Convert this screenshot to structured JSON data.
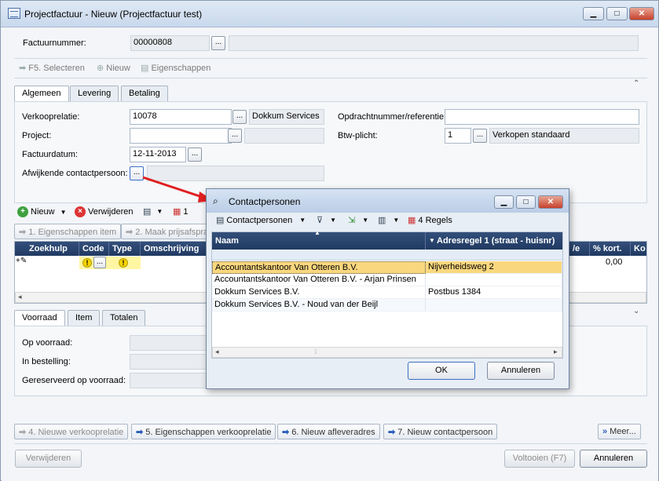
{
  "window": {
    "title": "Projectfactuur - Nieuw (Projectfactuur test)",
    "buttons": {
      "minimize": "▁",
      "maximize": "□",
      "close": "✕"
    }
  },
  "header": {
    "factuurnummer_label": "Factuurnummer:",
    "factuurnummer_value": "00000808",
    "dots": "..."
  },
  "toolbar": {
    "select": "F5. Selecteren",
    "new": "Nieuw",
    "properties": "Eigenschappen"
  },
  "tabs_top": [
    "Algemeen",
    "Levering",
    "Betaling"
  ],
  "form": {
    "verkooprelatie_label": "Verkooprelatie:",
    "verkooprelatie_value": "10078",
    "verkooprelatie_name": "Dokkum Services",
    "project_label": "Project:",
    "factuurdatum_label": "Factuurdatum:",
    "factuurdatum_value": "12-11-2013",
    "contact_label": "Afwijkende contactpersoon:",
    "opdracht_label": "Opdrachtnummer/referentie:",
    "btw_label": "Btw-plicht:",
    "btw_value": "1",
    "btw_name": "Verkopen standaard"
  },
  "lines_toolbar": {
    "new": "Nieuw",
    "delete": "Verwijderen",
    "count": "1"
  },
  "steps": {
    "step1": "1. Eigenschappen item",
    "step2": "2. Maak prijsafspra"
  },
  "lines_grid": {
    "headers": [
      "Zoekhulp",
      "Code",
      "Type",
      "Omschrijving",
      "/e",
      "% kort.",
      "Ko"
    ],
    "row_value": "0,00"
  },
  "tabs_bottom": [
    "Voorraad",
    "Item",
    "Totalen"
  ],
  "stock": {
    "op_voorraad": "Op voorraad:",
    "in_bestelling": "In bestelling:",
    "gereserveerd": "Gereserveerd op voorraad:"
  },
  "bottom_steps": {
    "s4": "4. Nieuwe verkooprelatie",
    "s5": "5. Eigenschappen verkooprelatie",
    "s6": "6. Nieuw afleveradres",
    "s7": "7. Nieuw contactpersoon",
    "more": "Meer..."
  },
  "footer": {
    "delete": "Verwijderen",
    "complete": "Voltooien (F7)",
    "cancel": "Annuleren"
  },
  "dialog": {
    "title": "Contactpersonen",
    "toolbar_label": "Contactpersonen",
    "rules": "4 Regels",
    "col_name": "Naam",
    "col_address": "Adresregel 1 (straat - huisnr)",
    "rows": [
      {
        "name": "Accountantskantoor Van Otteren B.V.",
        "address": "Nijverheidsweg 2"
      },
      {
        "name": "Accountantskantoor Van Otteren B.V. - Arjan Prinsen",
        "address": ""
      },
      {
        "name": "Dokkum Services B.V.",
        "address": "Postbus 1384"
      },
      {
        "name": "Dokkum Services B.V. - Noud van der Beijl",
        "address": ""
      }
    ],
    "ok": "OK",
    "cancel": "Annuleren"
  },
  "colors": {
    "accent": "#203a62",
    "highlight": "#f9d77e",
    "arrow": "#e02020"
  }
}
